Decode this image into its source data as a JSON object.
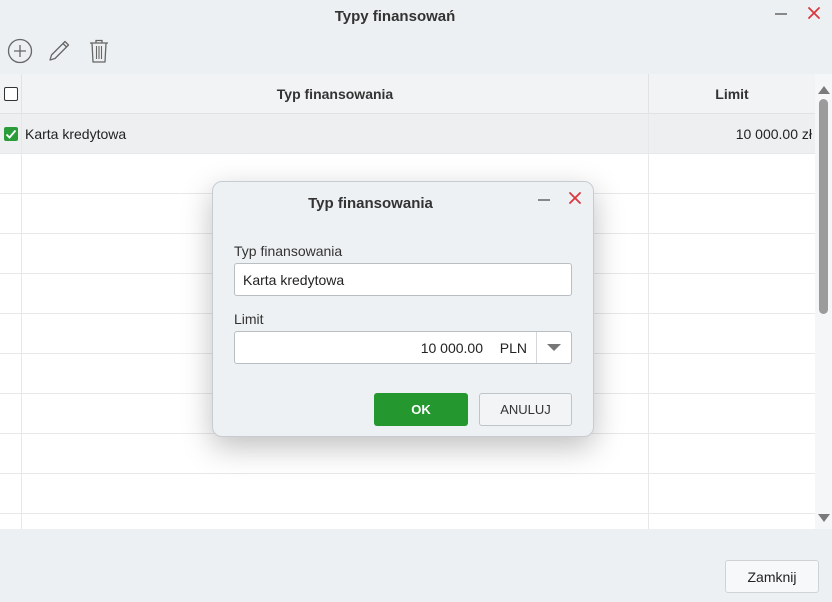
{
  "window": {
    "title": "Typy finansowań",
    "close_label": "Zamknij"
  },
  "toolbar": {
    "icons": [
      "plus-circle-icon",
      "pencil-icon",
      "trash-icon"
    ]
  },
  "grid": {
    "columns": [
      "Typ finansowania",
      "Limit"
    ],
    "rows": [
      {
        "checked": true,
        "type": "Karta kredytowa",
        "limit": "10 000.00 zł"
      }
    ]
  },
  "dialog": {
    "title": "Typ finansowania",
    "type_label": "Typ finansowania",
    "type_value": "Karta kredytowa",
    "limit_label": "Limit",
    "limit_value": "10 000.00",
    "currency": "PLN",
    "ok_label": "OK",
    "cancel_label": "ANULUJ"
  },
  "colors": {
    "accent_green": "#24982f",
    "close_red": "#d9363e"
  }
}
